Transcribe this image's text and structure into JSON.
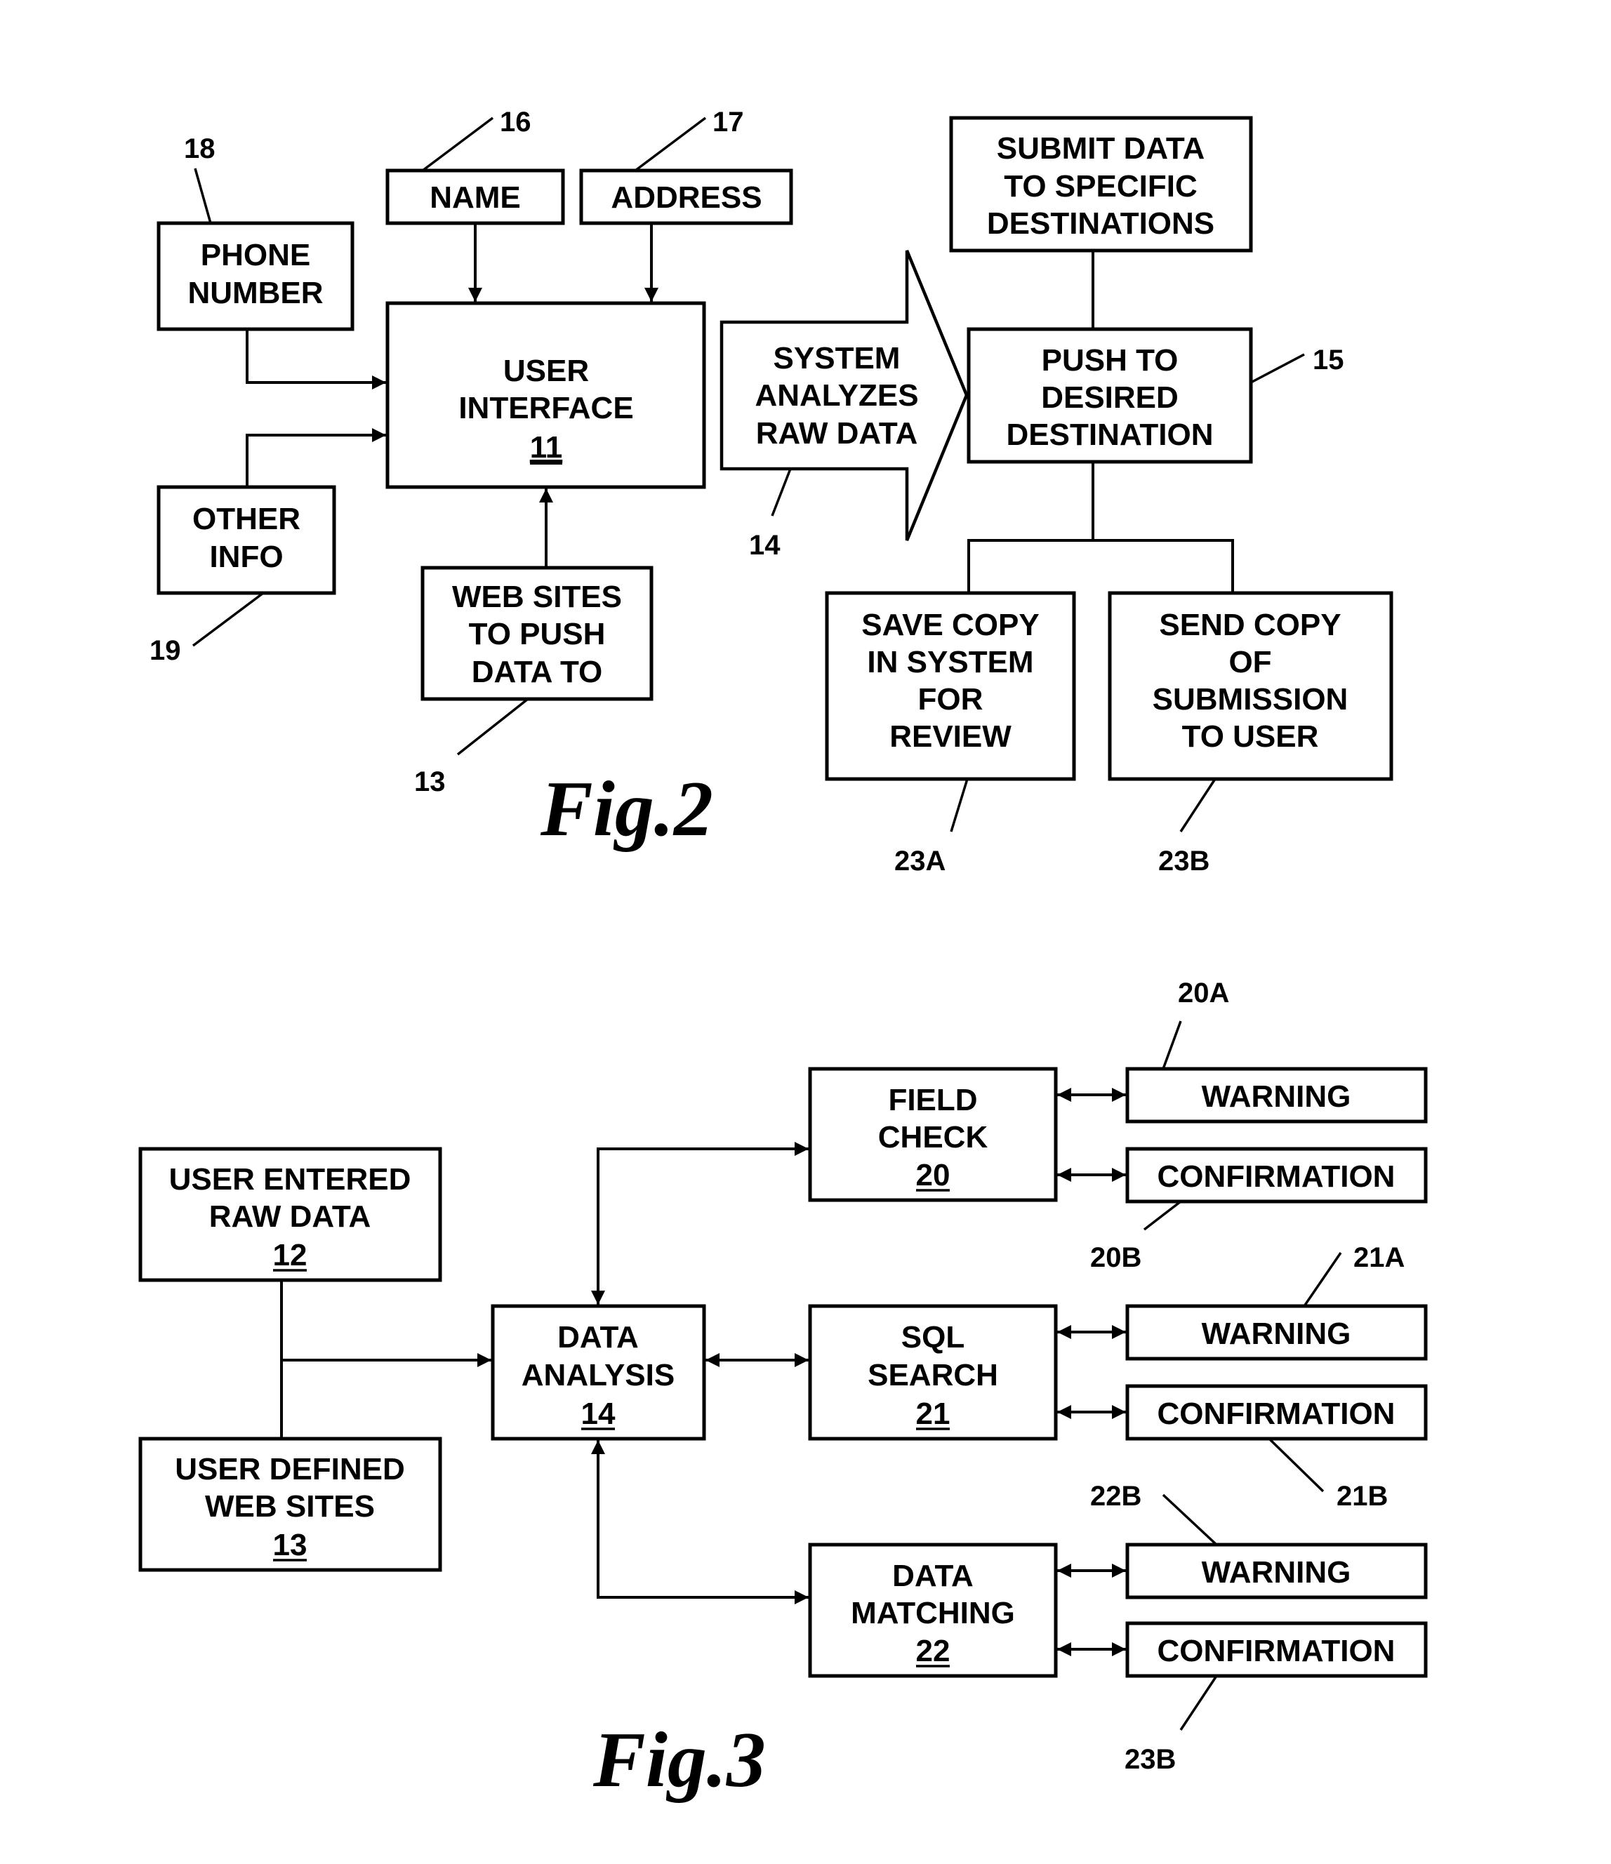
{
  "fig2": {
    "caption": "Fig.2",
    "boxes": {
      "name": [
        "NAME"
      ],
      "address": [
        "ADDRESS"
      ],
      "phone": [
        "PHONE",
        "NUMBER"
      ],
      "user_interface": [
        "USER",
        "INTERFACE"
      ],
      "user_interface_ref": "11",
      "other_info": [
        "OTHER",
        "INFO"
      ],
      "web_sites": [
        "WEB SITES",
        "TO PUSH",
        "DATA TO"
      ],
      "system_analyzes": [
        "SYSTEM",
        "ANALYZES",
        "RAW DATA"
      ],
      "submit_data": [
        "SUBMIT DATA",
        "TO SPECIFIC",
        "DESTINATIONS"
      ],
      "push_to": [
        "PUSH TO",
        "DESIRED",
        "DESTINATION"
      ],
      "save_copy": [
        "SAVE COPY",
        "IN SYSTEM",
        "FOR",
        "REVIEW"
      ],
      "send_copy": [
        "SEND COPY",
        "OF",
        "SUBMISSION",
        "TO USER"
      ]
    },
    "refs": {
      "name": "16",
      "address": "17",
      "phone": "18",
      "other_info": "19",
      "web_sites": "13",
      "system_analyzes": "14",
      "push_to": "15",
      "save_copy": "23A",
      "send_copy": "23B"
    }
  },
  "fig3": {
    "caption": "Fig.3",
    "boxes": {
      "user_entered": [
        "USER ENTERED",
        "RAW DATA"
      ],
      "user_entered_ref": "12",
      "user_defined": [
        "USER DEFINED",
        "WEB SITES"
      ],
      "user_defined_ref": "13",
      "data_analysis": [
        "DATA",
        "ANALYSIS"
      ],
      "data_analysis_ref": "14",
      "field_check": [
        "FIELD",
        "CHECK"
      ],
      "field_check_ref": "20",
      "sql_search": [
        "SQL",
        "SEARCH"
      ],
      "sql_search_ref": "21",
      "data_matching": [
        "DATA",
        "MATCHING"
      ],
      "data_matching_ref": "22",
      "warning": "WARNING",
      "confirmation": "CONFIRMATION"
    },
    "refs": {
      "warning_1": "20A",
      "confirmation_1": "20B",
      "warning_2": "21A",
      "confirmation_2": "21B",
      "warning_3": "22B",
      "confirmation_3": "23B"
    }
  }
}
